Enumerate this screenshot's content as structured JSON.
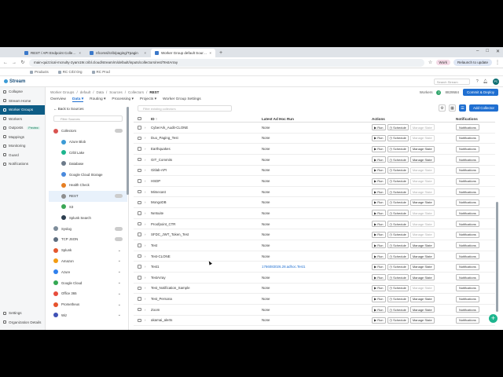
{
  "browser": {
    "tabs": [
      {
        "label": "REST / API Endpoint Collector",
        "active": false
      },
      {
        "label": "nfcorssl/crib/paging/Tpagin",
        "active": false
      },
      {
        "label": "Worker Group default Sources",
        "active": true
      }
    ],
    "new_tab": "+",
    "url": "main-quizzical-mcnulty-2yam19r.cribl.cloud/stream/m/default/inputs/collectors/rest/TestArray",
    "work_label": "Work",
    "relaunch_label": "Relaunch to update",
    "bookmarks": [
      "Products",
      "RC Crbl Org",
      "RC Prod"
    ],
    "window_controls": [
      "–",
      "□",
      "✕"
    ]
  },
  "app": {
    "logo": "Stream",
    "search_placeholder": "Search Stream",
    "avatar": "PC"
  },
  "leftnav": {
    "items": [
      {
        "label": "Collapse",
        "active": false
      },
      {
        "label": "Stream Home",
        "active": false
      },
      {
        "label": "Worker Groups",
        "active": true
      },
      {
        "label": "Workers",
        "active": false
      },
      {
        "label": "Outposts",
        "active": false,
        "badge": "Preview"
      },
      {
        "label": "Mappings",
        "active": false
      },
      {
        "label": "Monitoring",
        "active": false
      },
      {
        "label": "Guard",
        "active": false
      },
      {
        "label": "Notifications",
        "active": false
      }
    ],
    "bottom": [
      "Settings",
      "Organization Details"
    ]
  },
  "breadcrumb": {
    "items": [
      "Worker Groups",
      "/",
      "default",
      "/",
      "Data",
      "/",
      "Sources",
      "/",
      "Collectors",
      "/"
    ],
    "current": "REST"
  },
  "header_right": {
    "workers_label": "Workers",
    "workers_count": "2",
    "commit_id": "8829584",
    "commit_button": "Commit & Deploy"
  },
  "subtabs": [
    {
      "label": "Overview",
      "active": false
    },
    {
      "label": "Data ▾",
      "active": true
    },
    {
      "label": "Routing ▾",
      "active": false
    },
    {
      "label": "Processing ▾",
      "active": false
    },
    {
      "label": "Projects ▾",
      "active": false
    },
    {
      "label": "Worker Group Settings",
      "active": false
    }
  ],
  "panel": {
    "back_label": "Back to Sources",
    "filter_placeholder": "Filter Sources",
    "items": [
      {
        "label": "Collectors",
        "color": "#d9534f",
        "indent": 0,
        "type": "count"
      },
      {
        "label": "Azure Blob",
        "color": "#3c9bd6",
        "indent": 1
      },
      {
        "label": "Cribl Lake",
        "color": "#1db58e",
        "indent": 1
      },
      {
        "label": "Database",
        "color": "#6c7a89",
        "indent": 1
      },
      {
        "label": "Google Cloud Storage",
        "color": "#4a89dc",
        "indent": 1
      },
      {
        "label": "Health Check",
        "color": "#e67e22",
        "indent": 1
      },
      {
        "label": "REST",
        "color": "#8e8e8e",
        "indent": 1,
        "selected": true,
        "type": "count"
      },
      {
        "label": "S3",
        "color": "#3aa655",
        "indent": 1
      },
      {
        "label": "Splunk Search",
        "color": "#2c3e50",
        "indent": 1
      },
      {
        "label": "Syslog",
        "color": "#7d8c9a",
        "indent": 0,
        "type": "count"
      },
      {
        "label": "TCP JSON",
        "color": "#5d6d7e",
        "indent": 0,
        "type": "count"
      },
      {
        "label": "Splunk",
        "color": "#e4572e",
        "indent": 0,
        "type": "chevron"
      },
      {
        "label": "Amazon",
        "color": "#f39c12",
        "indent": 0,
        "type": "chevron"
      },
      {
        "label": "Azure",
        "color": "#2f80ed",
        "indent": 0,
        "type": "chevron"
      },
      {
        "label": "Google Cloud",
        "color": "#34a853",
        "indent": 0,
        "type": "chevron"
      },
      {
        "label": "Office 365",
        "color": "#e74c3c",
        "indent": 0,
        "type": "chevron"
      },
      {
        "label": "Prometheus",
        "color": "#e6522c",
        "indent": 0,
        "type": "chevron"
      },
      {
        "label": "Wiz",
        "color": "#3f51b5",
        "indent": 0,
        "type": "chevron"
      }
    ]
  },
  "table": {
    "filter_placeholder": "Filter existing collectors",
    "add_button": "Add Collector",
    "columns": {
      "id": "ID ↑",
      "last": "Latest Ad Hoc Run",
      "actions": "Actions",
      "notifications": "Notifications"
    },
    "action_labels": {
      "run": "▶ Run",
      "schedule": "◷ Schedule",
      "manage": "Manage State"
    },
    "notif_label": "Notifications",
    "rows": [
      {
        "id": "CyberArk_Audit-CLONE",
        "last": "None",
        "link": false,
        "manage": false
      },
      {
        "id": "Duo_Paging_Test",
        "last": "None",
        "link": false,
        "manage": false
      },
      {
        "id": "Earthquakes",
        "last": "None",
        "link": false,
        "manage": true
      },
      {
        "id": "GIT_Commits",
        "last": "None",
        "link": false,
        "manage": true
      },
      {
        "id": "Gitlab-API",
        "last": "None",
        "link": false,
        "manage": false
      },
      {
        "id": "HSDP",
        "last": "None",
        "link": false,
        "manage": false
      },
      {
        "id": "Mimecast",
        "last": "None",
        "link": false,
        "manage": false
      },
      {
        "id": "MongoDB",
        "last": "None",
        "link": false,
        "manage": true
      },
      {
        "id": "Netsuite",
        "last": "None",
        "link": false,
        "manage": false
      },
      {
        "id": "Proofpoint_CTR",
        "last": "None",
        "link": false,
        "manage": false
      },
      {
        "id": "SFDC_JWT_Token_Test",
        "last": "None",
        "link": false,
        "manage": false
      },
      {
        "id": "Test",
        "last": "None",
        "link": false,
        "manage": true
      },
      {
        "id": "Test-CLONE",
        "last": "None",
        "link": false,
        "manage": true
      },
      {
        "id": "Test1",
        "last": "1766083026.28.adhoc.Test1",
        "link": true,
        "manage": true
      },
      {
        "id": "TestArray",
        "last": "None",
        "link": false,
        "manage": true
      },
      {
        "id": "Test_Notification_Sample",
        "last": "None",
        "link": false,
        "manage": false
      },
      {
        "id": "Test_Persona",
        "last": "None",
        "link": false,
        "manage": true
      },
      {
        "id": "Zoom",
        "last": "None",
        "link": false,
        "manage": true
      },
      {
        "id": "akamai_alerts",
        "last": "None",
        "link": false,
        "manage": true
      }
    ]
  },
  "fab": "+"
}
